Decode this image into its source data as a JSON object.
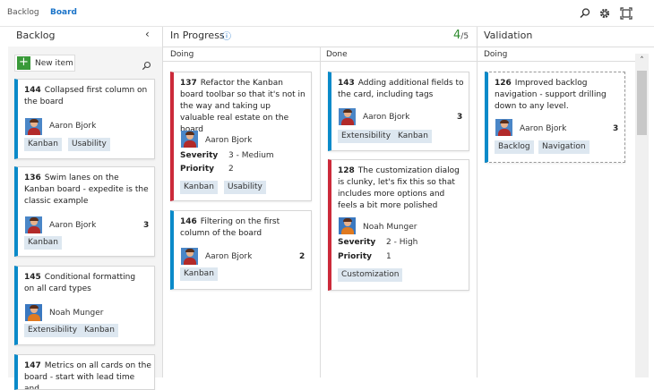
{
  "tabs": [
    {
      "label": "Backlog"
    },
    {
      "label": "Board"
    }
  ],
  "backlog": {
    "title": "Backlog",
    "new_item_label": "New item",
    "cards": [
      {
        "id": "144",
        "title": "Collapsed first  column on the board",
        "assignee": "Aaron Bjork",
        "tags": [
          "Kanban",
          "Usability"
        ],
        "effort": ""
      },
      {
        "id": "136",
        "title": "Swim lanes on the Kanban board - expedite is the classic example",
        "assignee": "Aaron Bjork",
        "tags": [
          "Kanban"
        ],
        "effort": "3"
      },
      {
        "id": "145",
        "title": "Conditional formatting on all card types",
        "assignee": "Noah Munger",
        "tags": [
          "Extensibility",
          "Kanban"
        ],
        "effort": ""
      },
      {
        "id": "147",
        "title": "Metrics on all cards on the board - start with lead time and",
        "assignee": "",
        "tags": [],
        "effort": ""
      }
    ]
  },
  "in_progress": {
    "title": "In Progress",
    "wip_current": "4",
    "wip_limit": "/5",
    "doing_label": "Doing",
    "done_label": "Done",
    "doing_cards": [
      {
        "id": "137",
        "title": "Refactor the Kanban board toolbar so that it's not in the way and taking up valuable real estate on the board",
        "assignee": "Aaron Bjork",
        "severity_label": "Severity",
        "severity": "3 - Medium",
        "priority_label": "Priority",
        "priority": "2",
        "tags": [
          "Kanban",
          "Usability"
        ]
      },
      {
        "id": "146",
        "title": "Filtering on the first column of the board",
        "assignee": "Aaron Bjork",
        "effort": "2",
        "tags": [
          "Kanban"
        ]
      }
    ],
    "done_cards": [
      {
        "id": "143",
        "title": "Adding additional fields to the card, including tags",
        "assignee": "Aaron Bjork",
        "effort": "3",
        "tags": [
          "Extensibility",
          "Kanban"
        ]
      },
      {
        "id": "128",
        "title": "The customization dialog is clunky, let's fix this so that includes more options and feels a bit more polished",
        "assignee": "Noah Munger",
        "severity_label": "Severity",
        "severity": "2 - High",
        "priority_label": "Priority",
        "priority": "1",
        "tags": [
          "Customization"
        ]
      }
    ]
  },
  "validation": {
    "title": "Validation",
    "doing_label": "Doing",
    "cards": [
      {
        "id": "126",
        "title": "Improved backlog navigation - support drilling down to any level.",
        "assignee": "Aaron Bjork",
        "effort": "3",
        "tags": [
          "Backlog",
          "Navigation"
        ]
      }
    ]
  },
  "colors": {
    "accent": "#1a73c8",
    "bug_bar": "#cc2a3a",
    "story_bar": "#0a8ac9",
    "wip_ok": "#2e8b2e",
    "tag_bg": "#dde7f0"
  },
  "icons": {
    "search": "search-icon",
    "settings": "gear-icon",
    "fullscreen": "fullscreen-icon",
    "collapse": "chevron-left-icon",
    "info": "info-icon",
    "add": "plus-icon"
  }
}
